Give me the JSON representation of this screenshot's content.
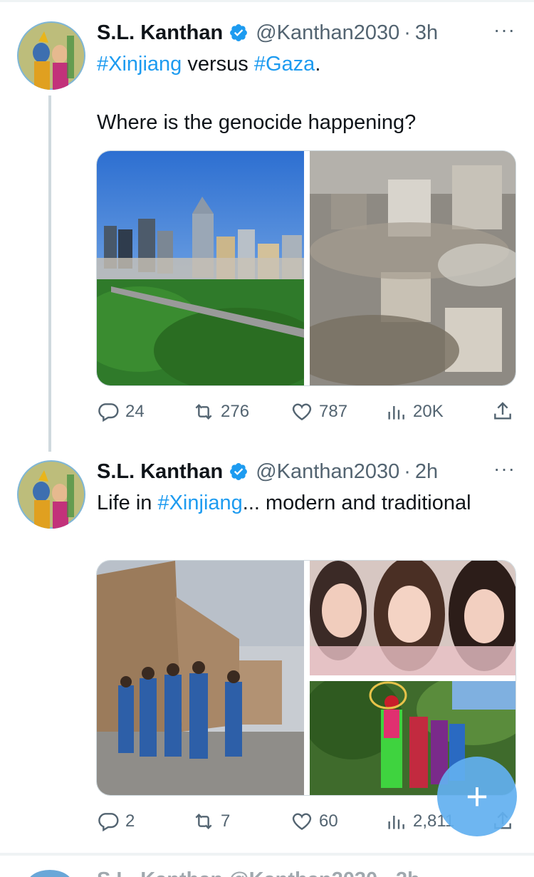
{
  "colors": {
    "accent": "#1d9bf0",
    "text": "#0f1419",
    "muted": "#536471",
    "divider": "#eff3f4"
  },
  "tweets": [
    {
      "name": "S.L. Kanthan",
      "handle": "@Kanthan2030",
      "separator": "·",
      "time": "3h",
      "more": "···",
      "text_parts": {
        "hashtag1": "#Xinjiang",
        "middle": " versus ",
        "hashtag2": "#Gaza",
        "end": ".",
        "line2": "Where is the genocide happening?"
      },
      "media": [
        "modern-city-skyline-photo",
        "destroyed-buildings-rubble-photo"
      ],
      "stats": {
        "replies": "24",
        "reposts": "276",
        "likes": "787",
        "views": "20K"
      }
    },
    {
      "name": "S.L. Kanthan",
      "handle": "@Kanthan2030",
      "separator": "·",
      "time": "2h",
      "more": "···",
      "text_parts": {
        "before": "Life in ",
        "hashtag": "#Xinjiang",
        "after": "... modern and traditional"
      },
      "media": [
        "students-walking-street-photo",
        "three-women-selfie-photo",
        "traditional-dancers-photo"
      ],
      "stats": {
        "replies": "2",
        "reposts": "7",
        "likes": "60",
        "views": "2,811"
      }
    }
  ],
  "next_tweet_peek": "S.L. Kanthan @Kanthan2030 · 2h",
  "fab": {
    "label": "+",
    "icon": "compose-plus-icon"
  }
}
